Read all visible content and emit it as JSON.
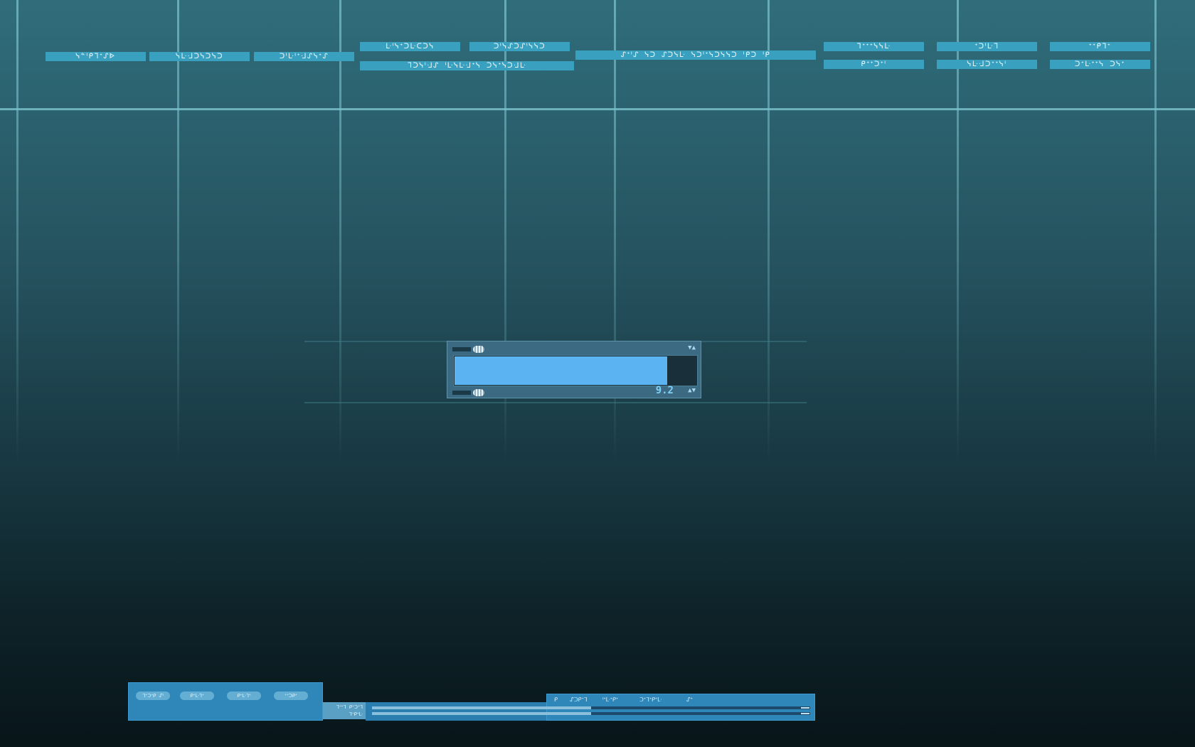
{
  "header": {
    "labels": [
      "ᓭᓐᑊᑭᒣᐩᔑᐈ",
      "ᓭᒷᒲᑐᓭᑐᓭᑐ",
      "ᑐᑊᒷᑊᐩᒲᔑᓭᐩᔑ",
      "ᒷᑊᓭᐩᑐᒷᑕᑐᓭ",
      "ᑐᑊᓭᔑᑐᔑᑊᓭᓭᑐ",
      "ᒣᑐᓭᑊᒲᔑ  ᑊᒷᓭᒷᒲᐩᓭ  ᑐᓭᐩᓭᑐᒲᒷ",
      "ᔑᐩᑊᔑ ᓭᑐ ᔑᑐᓭᒷ ᓭᑐᑊᐩᓭᑐᓭᓭᑐ ᑊᑭᑐ ᑊᑭ",
      "ᒣᐩᐩᐩᓭᓭᒷ",
      "ᐩᑐᑊᒷᒣ",
      "ᐩᐩᑭᒣᐩ",
      "ᑭᐩᐩᑐᐩᑊ",
      "ᓭᒷᒲᑐᐩᐩᓭᑊ",
      "ᑐᐩᒷᐩᐩᓭ ᑐᓭᐩ"
    ]
  },
  "dialog": {
    "progress": 0.88,
    "value": "9.2",
    "top_arrows": "▼▲",
    "bottom_arrows": "▲▼"
  },
  "taskbar": {
    "buttons": [
      "ᒣᐩᑐᐩᑭ ᔑᑊ",
      "ᑭᐩᒷᒣᐩ",
      "ᑭᐩᒷᒣᐩ",
      "ᐩᐩᑐᑭᐩ"
    ],
    "tray": [
      "ᒣᐩᐩᒣ ᑭᐩᑐᐩᒣ",
      "ᒣᐩᑭᐩᒷ"
    ],
    "menu": [
      "ᑭ",
      "ᔑᑐᑭᐩᒣ",
      "ᑊᐩᒷᐩᑭᐩ",
      "ᑐᐩᒣᐩᑭᐩᒷ",
      "ᔑᐩ"
    ],
    "slider_1": 0.5,
    "slider_2": 0.5
  },
  "colors": {
    "accent": "#3aa0bf",
    "fill": "#5cb3f2",
    "taskbar": "#2f86b8"
  }
}
